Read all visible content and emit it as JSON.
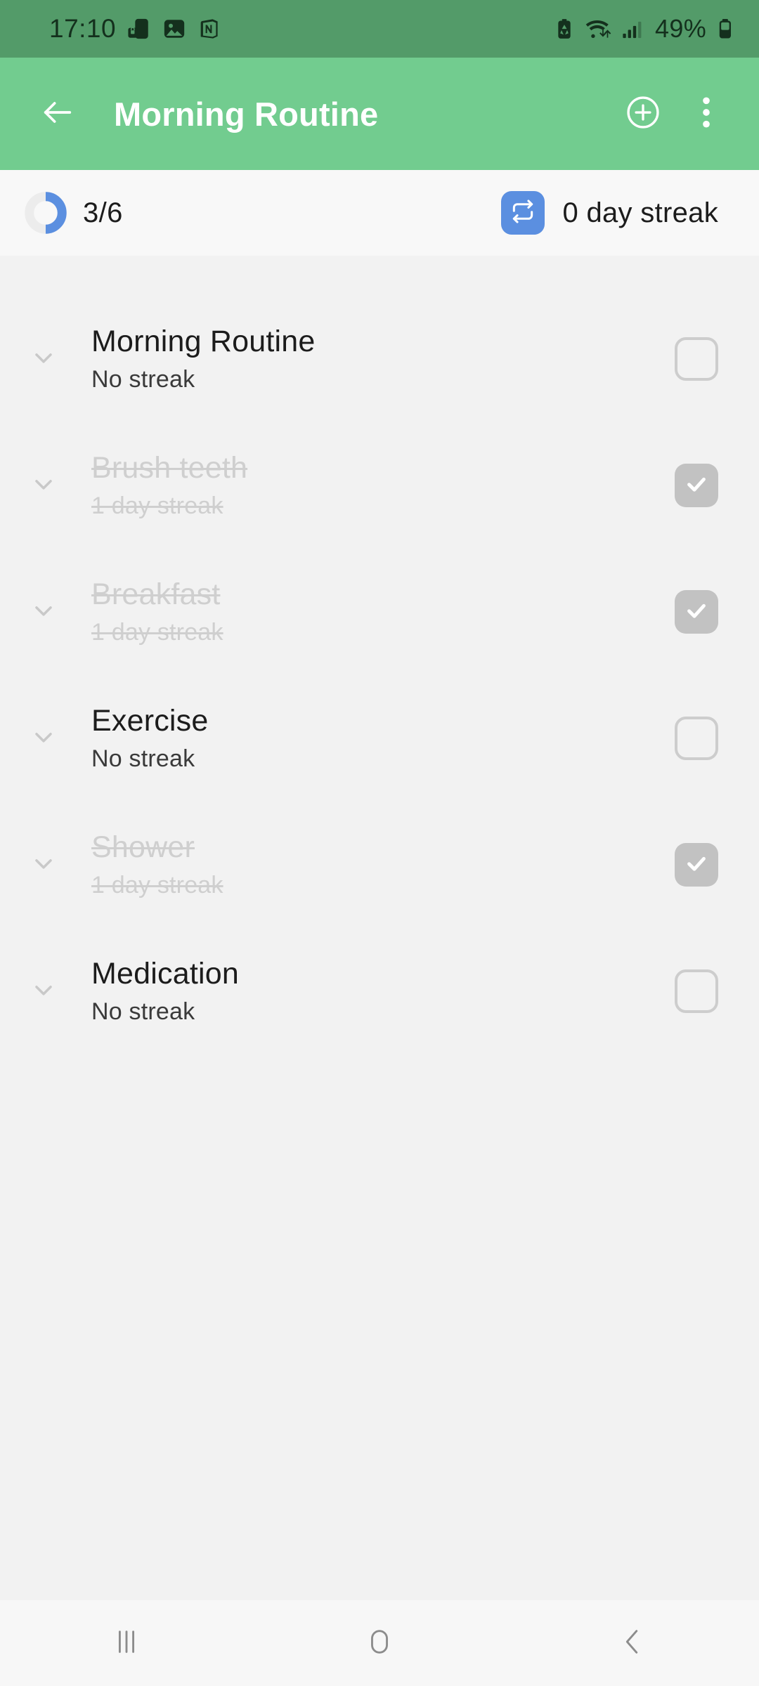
{
  "status_bar": {
    "time": "17:10",
    "battery_percent": "49%",
    "left_icons": [
      "phone-lock-icon",
      "photo-icon",
      "notion-icon"
    ],
    "right_icons": [
      "battery-saver-icon",
      "wifi-icon",
      "signal-bars-icon",
      "battery-icon"
    ],
    "background_color": "#539b69",
    "foreground_color": "#14301d"
  },
  "app_bar": {
    "title": "Morning Routine",
    "back_icon": "arrow-left-icon",
    "add_icon": "plus-circle-icon",
    "menu_icon": "more-vertical-icon",
    "background_color": "#72cc8f",
    "title_color": "#ffffff"
  },
  "stats": {
    "progress_label": "3/6",
    "progress_completed": 3,
    "progress_total": 6,
    "progress_percent": 50,
    "progress_color": "#5b8fe0",
    "progress_track_color": "#ececec",
    "streak_label": "0 day streak",
    "streak_icon": "repeat-icon",
    "streak_badge_color": "#5b8fe0"
  },
  "habits": [
    {
      "name": "Morning Routine",
      "streak": "No streak",
      "completed": false,
      "expand_icon": "chevron-down-icon",
      "checkbox_icon": "checkbox-empty-icon"
    },
    {
      "name": "Brush teeth",
      "streak": "1 day streak",
      "completed": true,
      "expand_icon": "chevron-down-icon",
      "checkbox_icon": "checkbox-checked-icon"
    },
    {
      "name": "Breakfast",
      "streak": "1 day streak",
      "completed": true,
      "expand_icon": "chevron-down-icon",
      "checkbox_icon": "checkbox-checked-icon"
    },
    {
      "name": "Exercise",
      "streak": "No streak",
      "completed": false,
      "expand_icon": "chevron-down-icon",
      "checkbox_icon": "checkbox-empty-icon"
    },
    {
      "name": "Shower",
      "streak": "1 day streak",
      "completed": true,
      "expand_icon": "chevron-down-icon",
      "checkbox_icon": "checkbox-checked-icon"
    },
    {
      "name": "Medication",
      "streak": "No streak",
      "completed": false,
      "expand_icon": "chevron-down-icon",
      "checkbox_icon": "checkbox-empty-icon"
    }
  ],
  "nav_bar": {
    "recents_icon": "recents-icon",
    "home_icon": "home-icon",
    "back_icon": "nav-back-icon",
    "background_color": "#f7f7f7",
    "icon_color": "#8c8c8c"
  }
}
